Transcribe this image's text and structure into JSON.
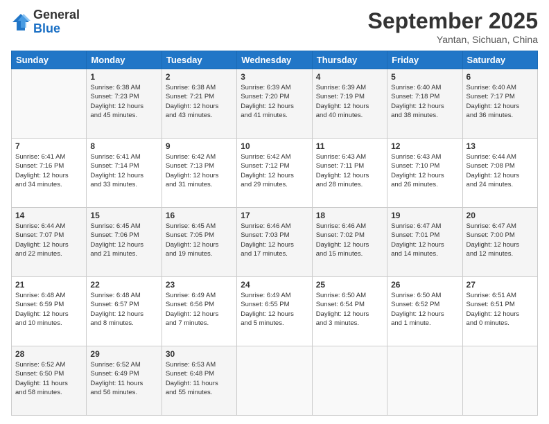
{
  "header": {
    "logo_general": "General",
    "logo_blue": "Blue",
    "month_title": "September 2025",
    "location": "Yantan, Sichuan, China"
  },
  "days_of_week": [
    "Sunday",
    "Monday",
    "Tuesday",
    "Wednesday",
    "Thursday",
    "Friday",
    "Saturday"
  ],
  "weeks": [
    [
      {
        "day": "",
        "info": ""
      },
      {
        "day": "1",
        "info": "Sunrise: 6:38 AM\nSunset: 7:23 PM\nDaylight: 12 hours\nand 45 minutes."
      },
      {
        "day": "2",
        "info": "Sunrise: 6:38 AM\nSunset: 7:21 PM\nDaylight: 12 hours\nand 43 minutes."
      },
      {
        "day": "3",
        "info": "Sunrise: 6:39 AM\nSunset: 7:20 PM\nDaylight: 12 hours\nand 41 minutes."
      },
      {
        "day": "4",
        "info": "Sunrise: 6:39 AM\nSunset: 7:19 PM\nDaylight: 12 hours\nand 40 minutes."
      },
      {
        "day": "5",
        "info": "Sunrise: 6:40 AM\nSunset: 7:18 PM\nDaylight: 12 hours\nand 38 minutes."
      },
      {
        "day": "6",
        "info": "Sunrise: 6:40 AM\nSunset: 7:17 PM\nDaylight: 12 hours\nand 36 minutes."
      }
    ],
    [
      {
        "day": "7",
        "info": "Sunrise: 6:41 AM\nSunset: 7:16 PM\nDaylight: 12 hours\nand 34 minutes."
      },
      {
        "day": "8",
        "info": "Sunrise: 6:41 AM\nSunset: 7:14 PM\nDaylight: 12 hours\nand 33 minutes."
      },
      {
        "day": "9",
        "info": "Sunrise: 6:42 AM\nSunset: 7:13 PM\nDaylight: 12 hours\nand 31 minutes."
      },
      {
        "day": "10",
        "info": "Sunrise: 6:42 AM\nSunset: 7:12 PM\nDaylight: 12 hours\nand 29 minutes."
      },
      {
        "day": "11",
        "info": "Sunrise: 6:43 AM\nSunset: 7:11 PM\nDaylight: 12 hours\nand 28 minutes."
      },
      {
        "day": "12",
        "info": "Sunrise: 6:43 AM\nSunset: 7:10 PM\nDaylight: 12 hours\nand 26 minutes."
      },
      {
        "day": "13",
        "info": "Sunrise: 6:44 AM\nSunset: 7:08 PM\nDaylight: 12 hours\nand 24 minutes."
      }
    ],
    [
      {
        "day": "14",
        "info": "Sunrise: 6:44 AM\nSunset: 7:07 PM\nDaylight: 12 hours\nand 22 minutes."
      },
      {
        "day": "15",
        "info": "Sunrise: 6:45 AM\nSunset: 7:06 PM\nDaylight: 12 hours\nand 21 minutes."
      },
      {
        "day": "16",
        "info": "Sunrise: 6:45 AM\nSunset: 7:05 PM\nDaylight: 12 hours\nand 19 minutes."
      },
      {
        "day": "17",
        "info": "Sunrise: 6:46 AM\nSunset: 7:03 PM\nDaylight: 12 hours\nand 17 minutes."
      },
      {
        "day": "18",
        "info": "Sunrise: 6:46 AM\nSunset: 7:02 PM\nDaylight: 12 hours\nand 15 minutes."
      },
      {
        "day": "19",
        "info": "Sunrise: 6:47 AM\nSunset: 7:01 PM\nDaylight: 12 hours\nand 14 minutes."
      },
      {
        "day": "20",
        "info": "Sunrise: 6:47 AM\nSunset: 7:00 PM\nDaylight: 12 hours\nand 12 minutes."
      }
    ],
    [
      {
        "day": "21",
        "info": "Sunrise: 6:48 AM\nSunset: 6:59 PM\nDaylight: 12 hours\nand 10 minutes."
      },
      {
        "day": "22",
        "info": "Sunrise: 6:48 AM\nSunset: 6:57 PM\nDaylight: 12 hours\nand 8 minutes."
      },
      {
        "day": "23",
        "info": "Sunrise: 6:49 AM\nSunset: 6:56 PM\nDaylight: 12 hours\nand 7 minutes."
      },
      {
        "day": "24",
        "info": "Sunrise: 6:49 AM\nSunset: 6:55 PM\nDaylight: 12 hours\nand 5 minutes."
      },
      {
        "day": "25",
        "info": "Sunrise: 6:50 AM\nSunset: 6:54 PM\nDaylight: 12 hours\nand 3 minutes."
      },
      {
        "day": "26",
        "info": "Sunrise: 6:50 AM\nSunset: 6:52 PM\nDaylight: 12 hours\nand 1 minute."
      },
      {
        "day": "27",
        "info": "Sunrise: 6:51 AM\nSunset: 6:51 PM\nDaylight: 12 hours\nand 0 minutes."
      }
    ],
    [
      {
        "day": "28",
        "info": "Sunrise: 6:52 AM\nSunset: 6:50 PM\nDaylight: 11 hours\nand 58 minutes."
      },
      {
        "day": "29",
        "info": "Sunrise: 6:52 AM\nSunset: 6:49 PM\nDaylight: 11 hours\nand 56 minutes."
      },
      {
        "day": "30",
        "info": "Sunrise: 6:53 AM\nSunset: 6:48 PM\nDaylight: 11 hours\nand 55 minutes."
      },
      {
        "day": "",
        "info": ""
      },
      {
        "day": "",
        "info": ""
      },
      {
        "day": "",
        "info": ""
      },
      {
        "day": "",
        "info": ""
      }
    ]
  ]
}
